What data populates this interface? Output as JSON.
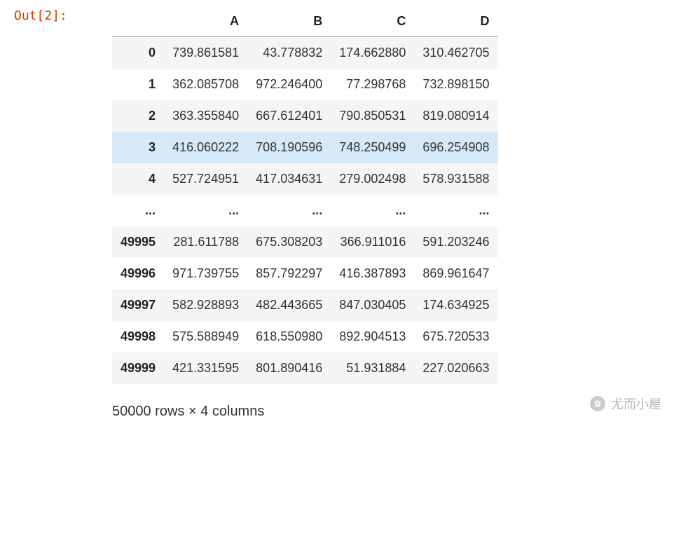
{
  "out_label": "Out[2]:",
  "columns": [
    "A",
    "B",
    "C",
    "D"
  ],
  "rows": [
    {
      "idx": "0",
      "vals": [
        "739.861581",
        "43.778832",
        "174.662880",
        "310.462705"
      ],
      "highlight": false
    },
    {
      "idx": "1",
      "vals": [
        "362.085708",
        "972.246400",
        "77.298768",
        "732.898150"
      ],
      "highlight": false
    },
    {
      "idx": "2",
      "vals": [
        "363.355840",
        "667.612401",
        "790.850531",
        "819.080914"
      ],
      "highlight": false
    },
    {
      "idx": "3",
      "vals": [
        "416.060222",
        "708.190596",
        "748.250499",
        "696.254908"
      ],
      "highlight": true
    },
    {
      "idx": "4",
      "vals": [
        "527.724951",
        "417.034631",
        "279.002498",
        "578.931588"
      ],
      "highlight": false
    },
    {
      "idx": "...",
      "vals": [
        "...",
        "...",
        "...",
        "..."
      ],
      "highlight": false,
      "ellipsis": true
    },
    {
      "idx": "49995",
      "vals": [
        "281.611788",
        "675.308203",
        "366.911016",
        "591.203246"
      ],
      "highlight": false
    },
    {
      "idx": "49996",
      "vals": [
        "971.739755",
        "857.792297",
        "416.387893",
        "869.961647"
      ],
      "highlight": false
    },
    {
      "idx": "49997",
      "vals": [
        "582.928893",
        "482.443665",
        "847.030405",
        "174.634925"
      ],
      "highlight": false
    },
    {
      "idx": "49998",
      "vals": [
        "575.588949",
        "618.550980",
        "892.904513",
        "675.720533"
      ],
      "highlight": false
    },
    {
      "idx": "49999",
      "vals": [
        "421.331595",
        "801.890416",
        "51.931884",
        "227.020663"
      ],
      "highlight": false
    }
  ],
  "shape_text": "50000 rows × 4 columns",
  "watermark_text": "尤而小屋"
}
